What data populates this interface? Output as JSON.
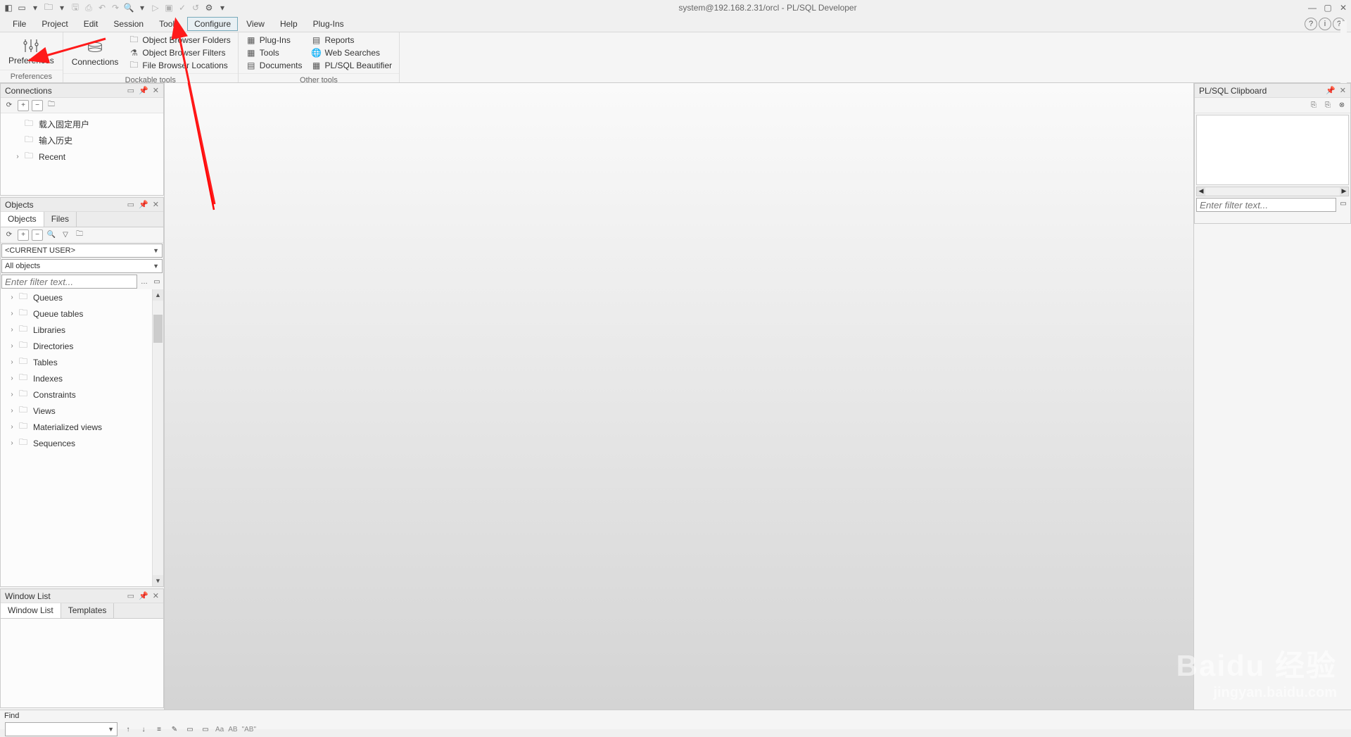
{
  "window": {
    "title": "system@192.168.2.31/orcl - PL/SQL Developer",
    "min": "—",
    "max": "▢",
    "close": "✕"
  },
  "menu": {
    "items": [
      "File",
      "Project",
      "Edit",
      "Session",
      "Tools",
      "Configure",
      "View",
      "Help",
      "Plug-Ins"
    ],
    "active_index": 5
  },
  "ribbon": {
    "group1": {
      "label": "Preferences",
      "btn": "Preferences"
    },
    "group2": {
      "label": "Dockable tools",
      "btn": "Connections",
      "items": [
        "Object Browser Folders",
        "Object Browser Filters",
        "File Browser Locations"
      ]
    },
    "group3": {
      "label": "Other tools",
      "col1": [
        "Plug-Ins",
        "Tools",
        "Documents"
      ],
      "col2": [
        "Reports",
        "Web Searches",
        "PL/SQL Beautifier"
      ]
    }
  },
  "connections": {
    "title": "Connections",
    "items": [
      "载入固定用户",
      "输入历史",
      "Recent"
    ]
  },
  "objects": {
    "title": "Objects",
    "tabs": [
      "Objects",
      "Files"
    ],
    "user_dd": "<CURRENT USER>",
    "filter_dd": "All objects",
    "filter_placeholder": "Enter filter text...",
    "tree": [
      "Queues",
      "Queue tables",
      "Libraries",
      "Directories",
      "Tables",
      "Indexes",
      "Constraints",
      "Views",
      "Materialized views",
      "Sequences"
    ]
  },
  "window_list": {
    "title": "Window List",
    "tabs": [
      "Window List",
      "Templates"
    ]
  },
  "clipboard": {
    "title": "PL/SQL Clipboard",
    "filter_placeholder": "Enter filter text..."
  },
  "find": {
    "label": "Find"
  },
  "watermark": {
    "line1": "Baidu 经验",
    "line2": "jingyan.baidu.com"
  }
}
